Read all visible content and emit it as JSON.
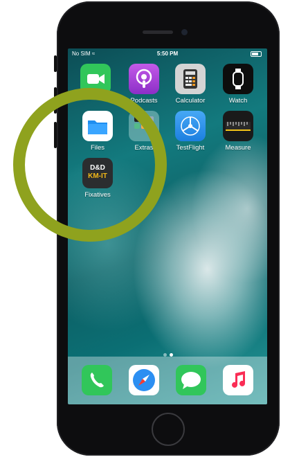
{
  "status": {
    "carrier": "No SIM",
    "time": "5:50 PM"
  },
  "apps_row1": [
    {
      "label": "",
      "icon": "facetime-icon",
      "color": "#31c65a"
    },
    {
      "label": "Podcasts",
      "icon": "podcasts-icon",
      "color": "#a443d9"
    },
    {
      "label": "Calculator",
      "icon": "calculator-icon",
      "color": "#d9d9d9"
    },
    {
      "label": "Watch",
      "icon": "watch-icon",
      "color": "#111111"
    }
  ],
  "apps_row2": [
    {
      "label": "Files",
      "icon": "files-icon",
      "color": "#ffffff"
    },
    {
      "label": "Extras",
      "icon": "extras-folder-icon",
      "color": "#6aa6a6"
    },
    {
      "label": "TestFlight",
      "icon": "testflight-icon",
      "color": "#2b8fe6"
    },
    {
      "label": "Measure",
      "icon": "measure-icon",
      "color": "#1a1a1a"
    }
  ],
  "apps_row3": [
    {
      "label": "Fixatives",
      "icon": "fixatives-icon",
      "color": "#2b2d2f",
      "line1": "D&D",
      "line2": "KM-IT"
    }
  ],
  "dock": [
    {
      "icon": "phone-icon",
      "color": "#31c65a"
    },
    {
      "icon": "safari-icon",
      "color": "#ffffff"
    },
    {
      "icon": "messages-icon",
      "color": "#31c65a"
    },
    {
      "icon": "music-icon",
      "color": "#ffffff"
    }
  ],
  "highlight_color": "#8fa21e"
}
